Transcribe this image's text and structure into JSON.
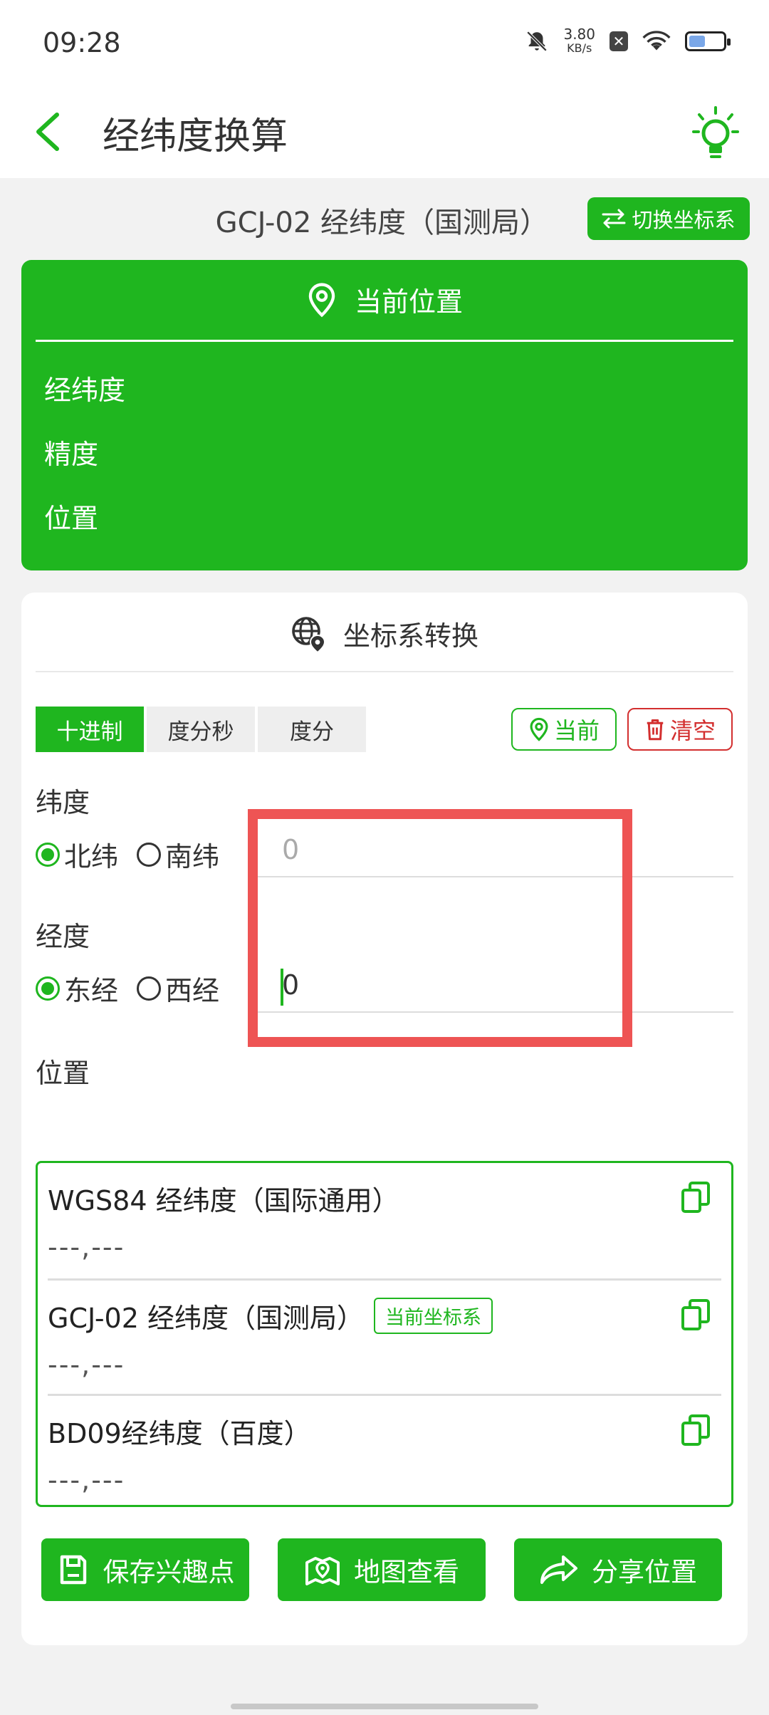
{
  "status": {
    "time": "09:28",
    "net_speed_value": "3.80",
    "net_speed_unit": "KB/s"
  },
  "header": {
    "title": "经纬度换算"
  },
  "coord_system": {
    "label": "GCJ-02 经纬度（国测局）",
    "switch_label": "切换坐标系"
  },
  "current_location": {
    "title": "当前位置",
    "rows": [
      "经纬度",
      "精度",
      "位置"
    ]
  },
  "conversion": {
    "title": "坐标系转换",
    "tabs": [
      "十进制",
      "度分秒",
      "度分"
    ],
    "current_btn": "当前",
    "clear_btn": "清空",
    "latitude": {
      "label": "纬度",
      "options": [
        "北纬",
        "南纬"
      ],
      "placeholder": "0"
    },
    "longitude": {
      "label": "经度",
      "options": [
        "东经",
        "西经"
      ],
      "value": "0"
    },
    "position_label": "位置"
  },
  "results": [
    {
      "title": "WGS84 经纬度（国际通用）",
      "value": "---,---"
    },
    {
      "title": "GCJ-02 经纬度（国测局）",
      "badge": "当前坐标系",
      "value": "---,---"
    },
    {
      "title": "BD09经纬度（百度）",
      "value": "---,---"
    }
  ],
  "actions": {
    "save": "保存兴趣点",
    "map": "地图查看",
    "share": "分享位置"
  },
  "colors": {
    "accent": "#1fb61f",
    "danger": "#d32f2f",
    "highlight": "#ee5454"
  }
}
